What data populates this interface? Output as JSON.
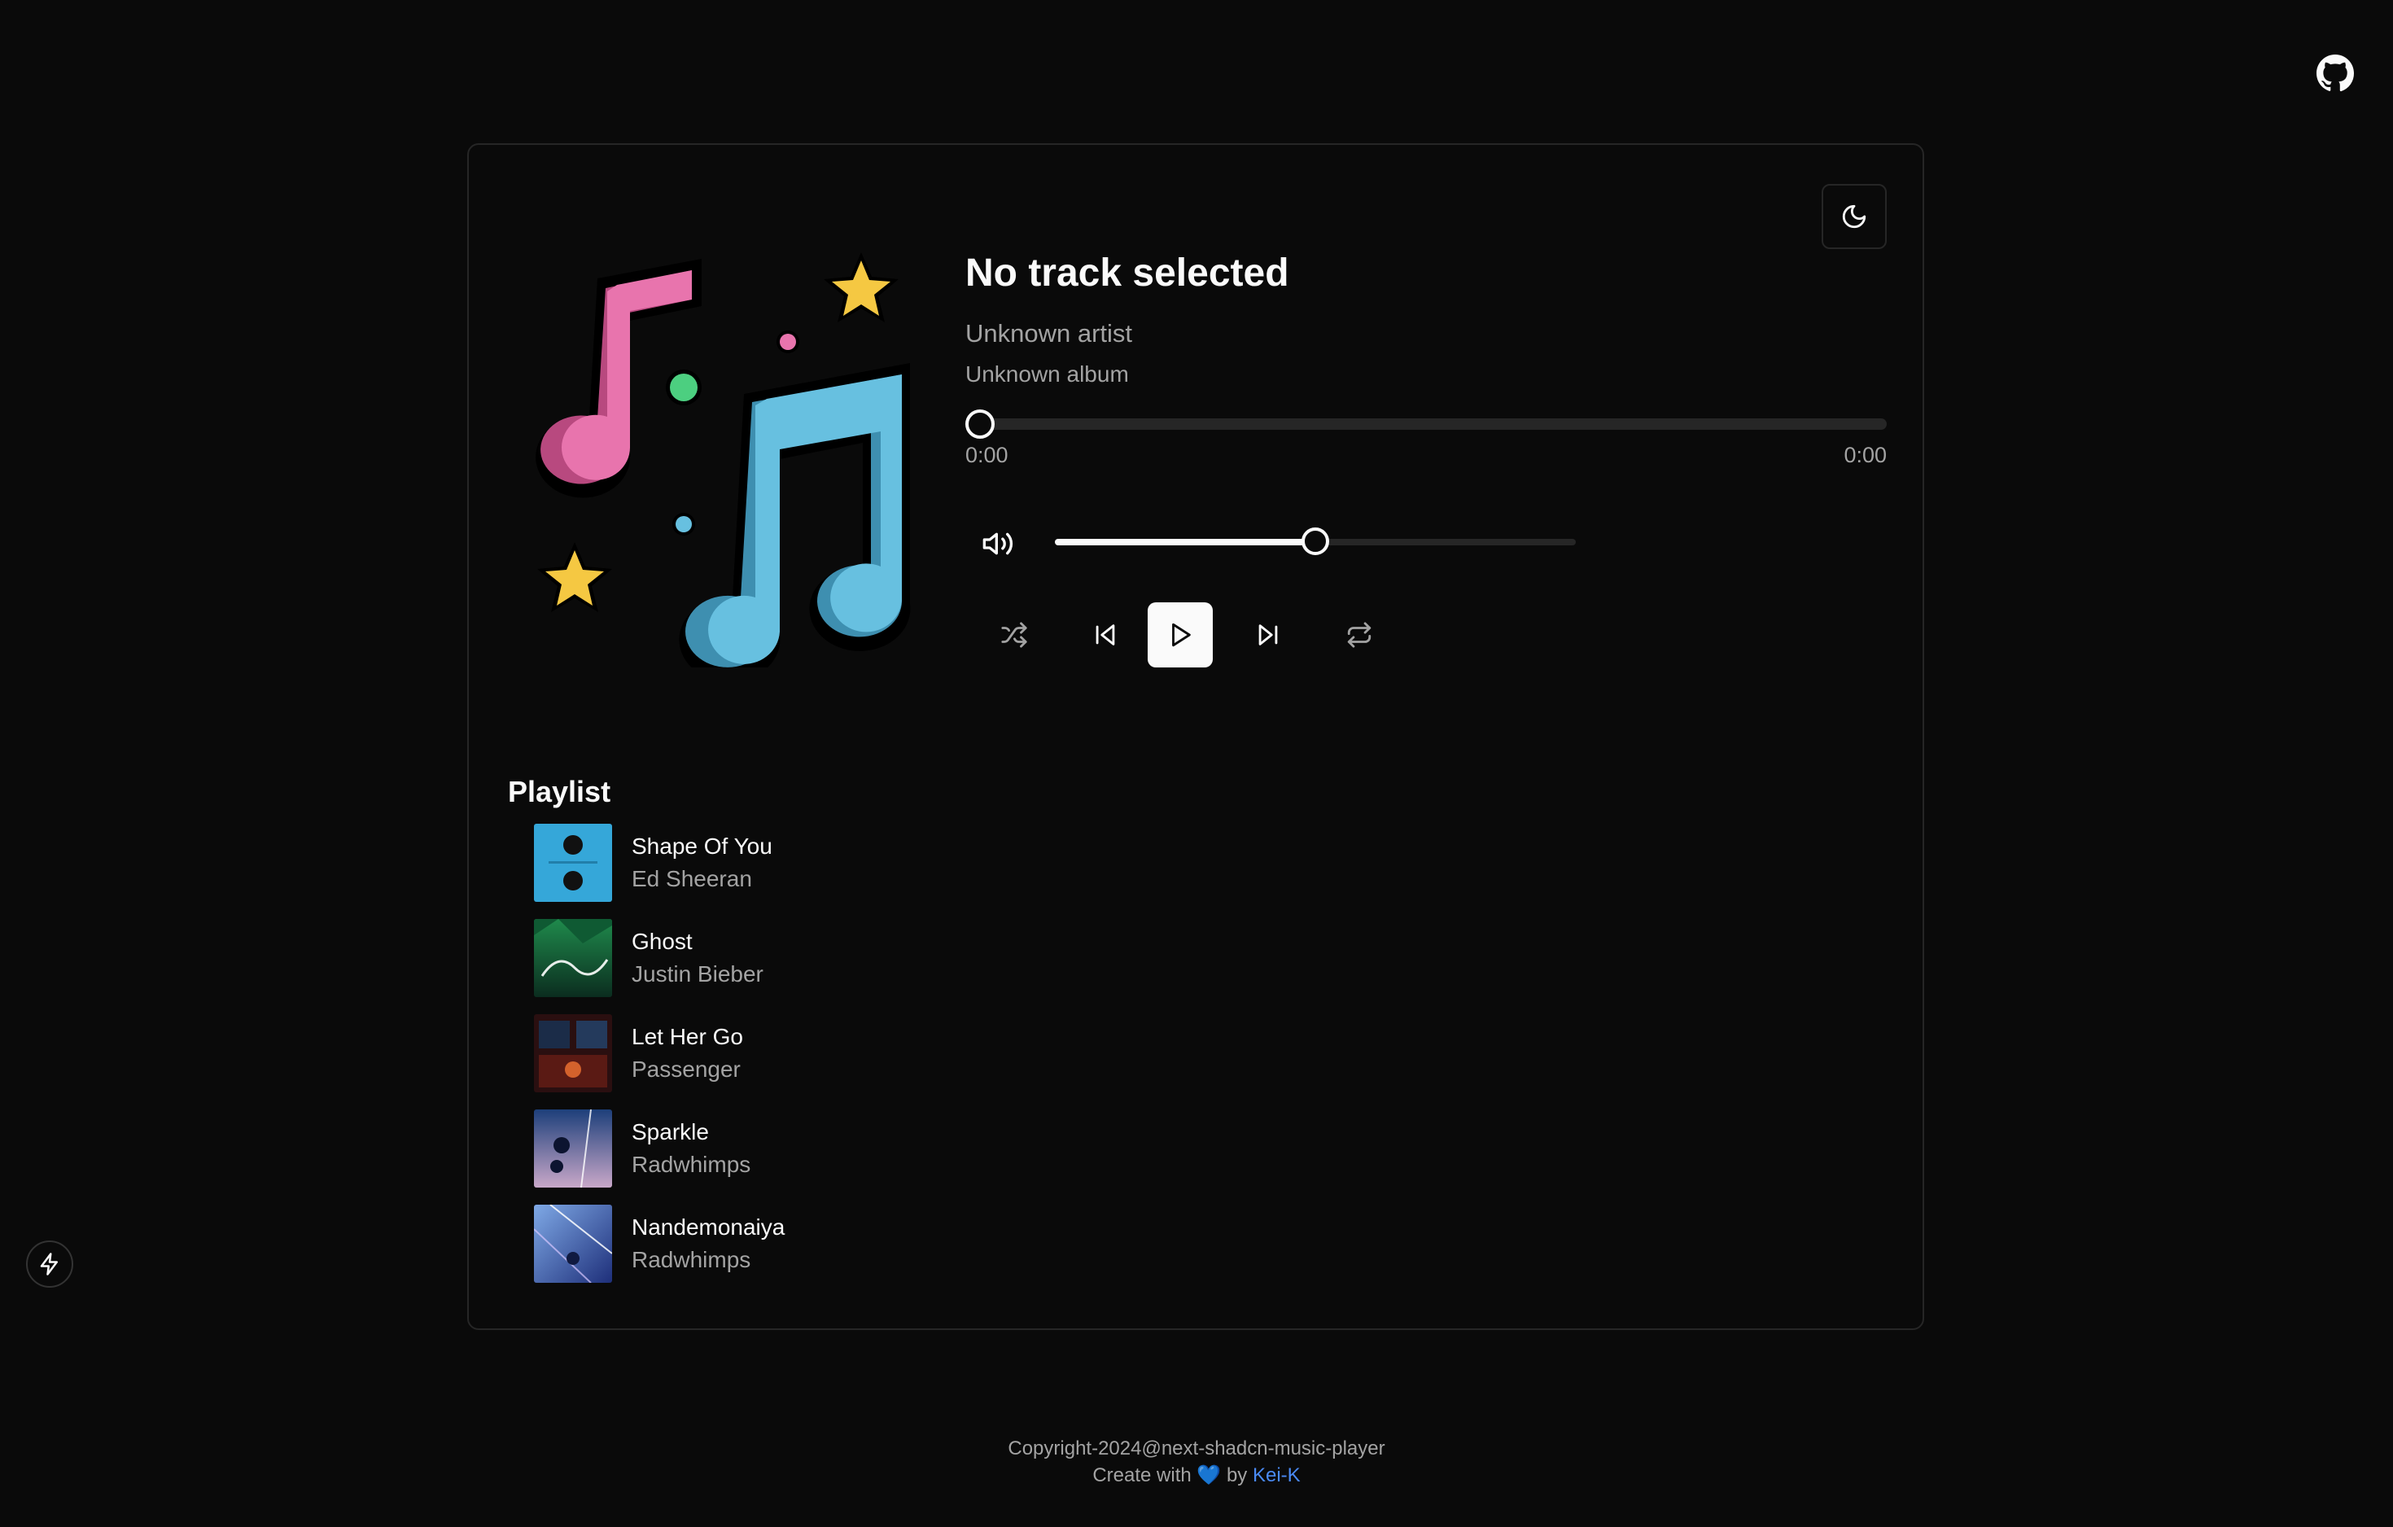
{
  "player": {
    "title": "No track selected",
    "artist": "Unknown artist",
    "album": "Unknown album",
    "current_time": "0:00",
    "total_time": "0:00",
    "progress": 0,
    "volume": 0.5
  },
  "playlist": {
    "title": "Playlist",
    "items": [
      {
        "name": "Shape Of You",
        "artist": "Ed Sheeran"
      },
      {
        "name": "Ghost",
        "artist": "Justin Bieber"
      },
      {
        "name": "Let Her Go",
        "artist": "Passenger"
      },
      {
        "name": "Sparkle",
        "artist": "Radwhimps"
      },
      {
        "name": "Nandemonaiya",
        "artist": "Radwhimps"
      }
    ]
  },
  "footer": {
    "copyright": "Copyright-2024@next-shadcn-music-player",
    "create_prefix": "Create with",
    "heart": "💙",
    "by": "by",
    "author": "Kei-K"
  },
  "colors": {
    "background": "#0a0a0a",
    "foreground": "#fafafa",
    "muted": "#a3a3a3",
    "border": "#262626",
    "link": "#4a8af4"
  },
  "icons": {
    "github": "github-icon",
    "theme": "moon-icon",
    "volume": "volume-icon",
    "shuffle": "shuffle-icon",
    "previous": "skip-back-icon",
    "play": "play-icon",
    "next": "skip-forward-icon",
    "repeat": "repeat-icon",
    "devtools": "lightning-bolt-icon"
  }
}
